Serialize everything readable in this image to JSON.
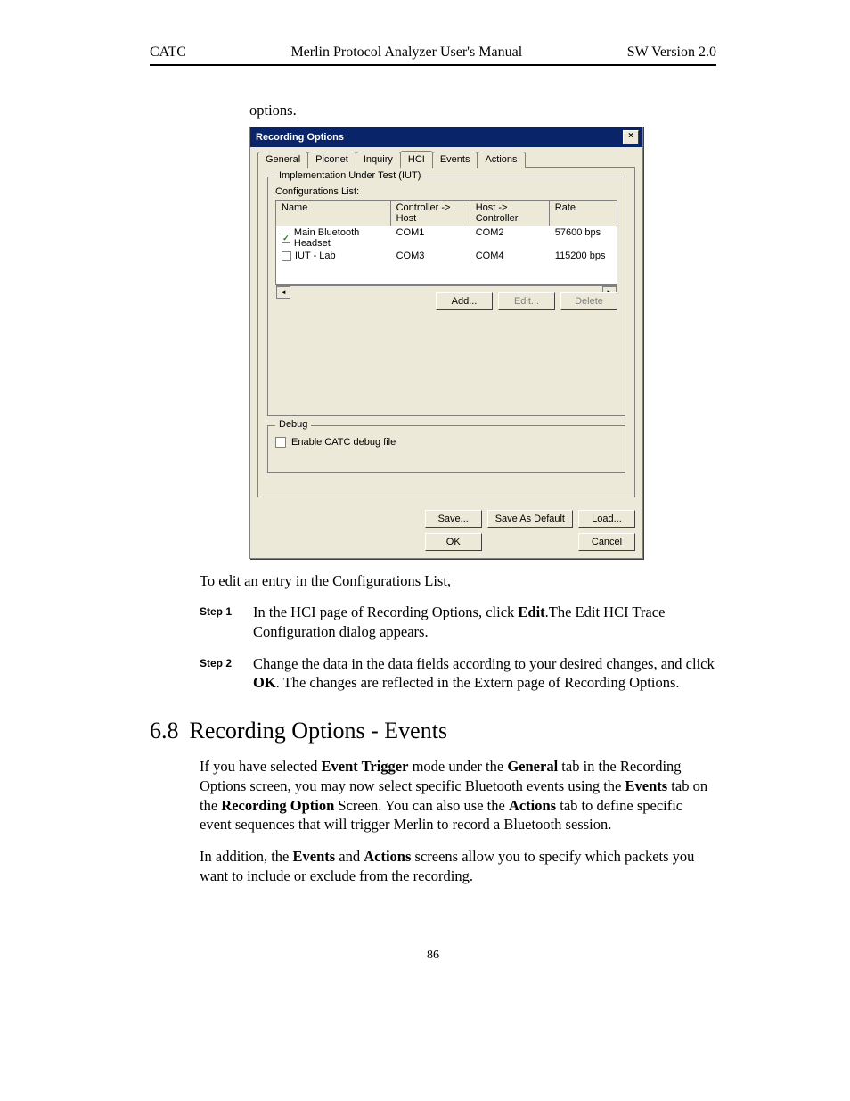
{
  "header": {
    "left": "CATC",
    "center": "Merlin Protocol Analyzer User's Manual",
    "right": "SW Version 2.0"
  },
  "continued": "options.",
  "dialog": {
    "title": "Recording Options",
    "close_glyph": "×",
    "tabs": {
      "general": "General",
      "piconet": "Piconet",
      "inquiry": "Inquiry",
      "hci": "HCI",
      "events": "Events",
      "actions": "Actions"
    },
    "iut_group": "Implementation Under Test (IUT)",
    "cfg_label": "Configurations List:",
    "columns": {
      "name": "Name",
      "c2h": "Controller -> Host",
      "h2c": "Host -> Controller",
      "rate": "Rate"
    },
    "rows": [
      {
        "checked": true,
        "name": "Main Bluetooth Headset",
        "c2h": "COM1",
        "h2c": "COM2",
        "rate": "57600 bps"
      },
      {
        "checked": false,
        "name": "IUT - Lab",
        "c2h": "COM3",
        "h2c": "COM4",
        "rate": "115200 bps"
      }
    ],
    "scroll": {
      "left": "◄",
      "right": "►"
    },
    "btn_add": "Add...",
    "btn_edit": "Edit...",
    "btn_delete": "Delete",
    "debug_group": "Debug",
    "debug_chk": "Enable CATC debug file",
    "btn_save": "Save...",
    "btn_savedef": "Save As Default",
    "btn_load": "Load...",
    "btn_ok": "OK",
    "btn_cancel": "Cancel"
  },
  "para_edit": "To edit an entry in the Configurations List,",
  "steps": {
    "s1_label": "Step 1",
    "s1_a": "In the HCI page of Recording Options, click ",
    "s1_bold": "Edit",
    "s1_b": ".The Edit HCI Trace Configuration dialog appears.",
    "s2_label": "Step 2",
    "s2_a": "Change the data in the data fields according to your desired changes, and click ",
    "s2_bold": "OK",
    "s2_b": ". The changes are reflected in the Extern page of Recording Options."
  },
  "section": {
    "num": "6.8",
    "title": "Recording Options - Events"
  },
  "p1": {
    "a": "If you have selected ",
    "b": "Event Trigger",
    "c": " mode under the ",
    "d": "General",
    "e": " tab in the Recording Options screen, you may now select specific Bluetooth events using the ",
    "f": "Events",
    "g": " tab on the ",
    "h": "Recording Option",
    "i": " Screen. You can also use the ",
    "j": "Actions",
    "k": " tab to define specific event sequences that will trigger Merlin to record a Bluetooth session."
  },
  "p2": {
    "a": "In addition, the ",
    "b": "Events",
    "c": " and ",
    "d": "Actions",
    "e": " screens allow you to specify which packets you want to include or exclude from the recording."
  },
  "pagenum": "86"
}
